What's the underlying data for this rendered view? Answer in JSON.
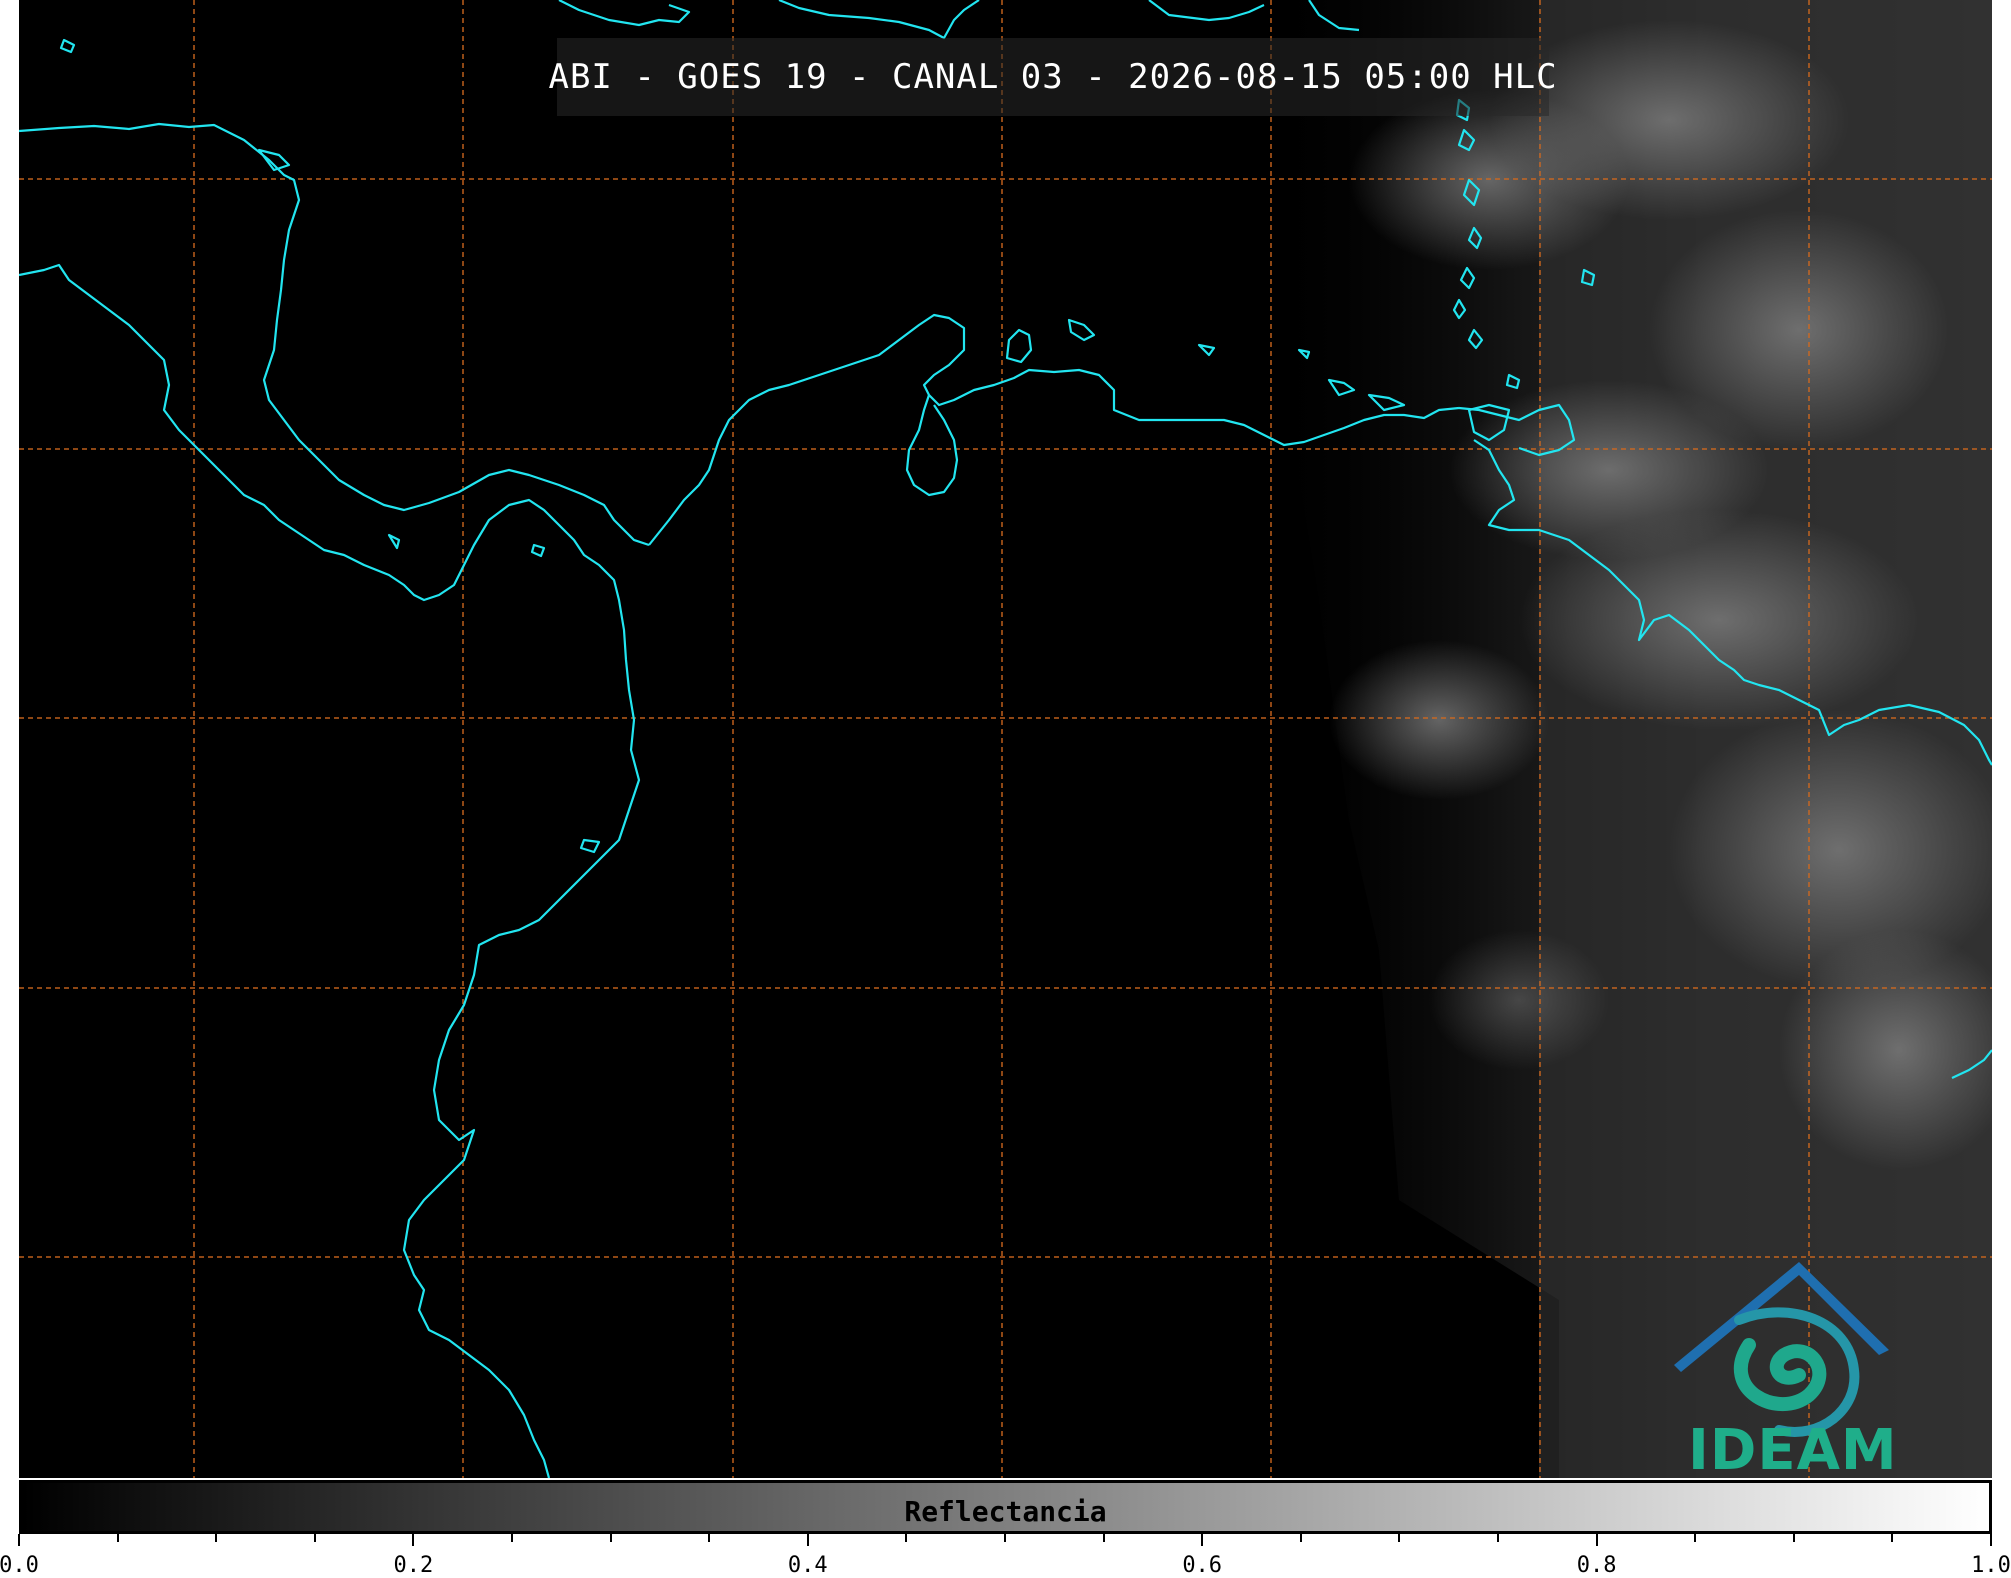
{
  "title": "ABI - GOES 19 - CANAL 03 - 2026-08-15 05:00 HLC",
  "map": {
    "coastline_color": "#22e5f0",
    "grid_color": "#d2691e",
    "background_color": "#000000"
  },
  "colorbar": {
    "label": "Reflectancia",
    "range": [
      0.0,
      1.0
    ],
    "colormap": "grayscale",
    "ticks": [
      "0.0",
      "0.2",
      "0.4",
      "0.6",
      "0.8",
      "1.0"
    ]
  },
  "logo": {
    "text": "IDEAM",
    "icon": "ideam-swirl-mountain-icon"
  }
}
